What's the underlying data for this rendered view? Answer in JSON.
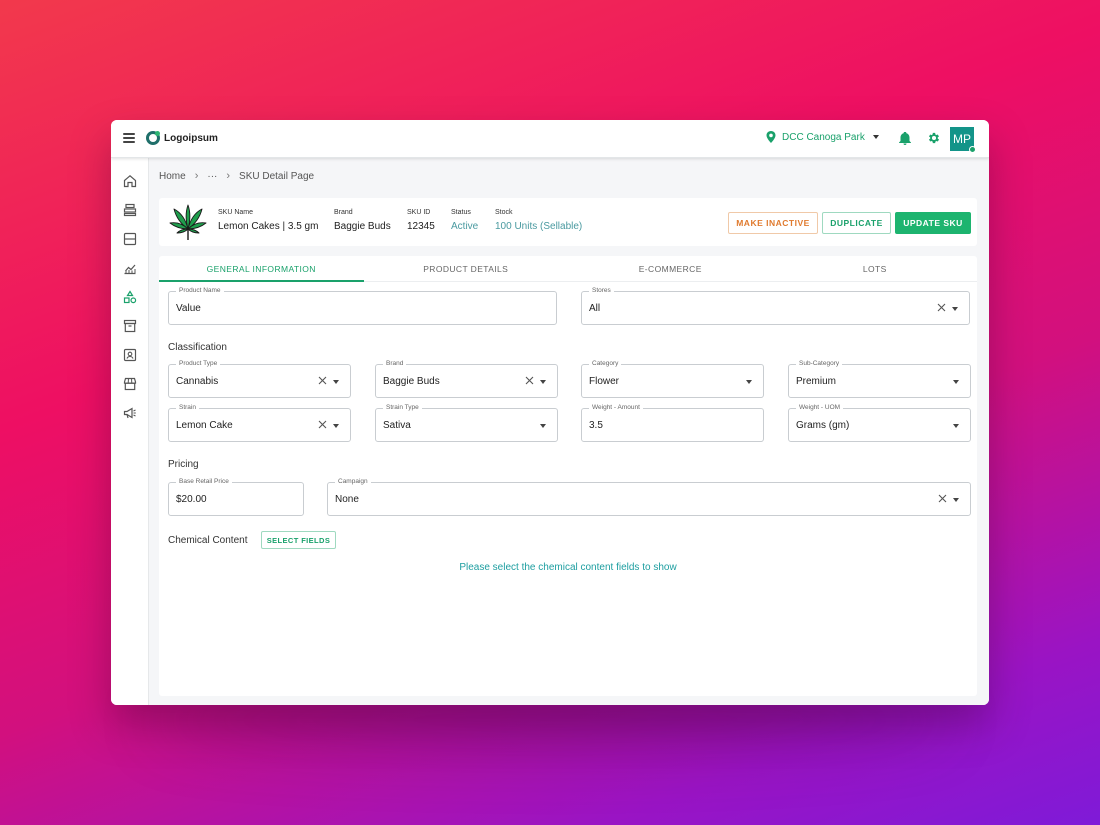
{
  "topbar": {
    "logo_text": "Logoipsum",
    "store_name": "DCC Canoga Park",
    "avatar_initials": "MP"
  },
  "breadcrumb": {
    "home": "Home",
    "ellipsis": "···",
    "current": "SKU Detail Page"
  },
  "sku": {
    "name_label": "SKU Name",
    "name_value": "Lemon Cakes | 3.5 gm",
    "brand_label": "Brand",
    "brand_value": "Baggie Buds",
    "id_label": "SKU ID",
    "id_value": "12345",
    "status_label": "Status",
    "status_value": "Active",
    "stock_label": "Stock",
    "stock_value": "100 Units (Sellable)"
  },
  "actions": {
    "make_inactive": "MAKE INACTIVE",
    "duplicate": "DUPLICATE",
    "update": "UPDATE SKU"
  },
  "tabs": [
    {
      "label": "GENERAL INFORMATION",
      "active": true
    },
    {
      "label": "PRODUCT DETAILS",
      "active": false
    },
    {
      "label": "E-COMMERCE",
      "active": false
    },
    {
      "label": "LOTS",
      "active": false
    }
  ],
  "form": {
    "product_name": {
      "label": "Product Name",
      "value": "Value"
    },
    "stores": {
      "label": "Stores",
      "value": "All"
    },
    "classification_title": "Classification",
    "product_type": {
      "label": "Product Type",
      "value": "Cannabis"
    },
    "brand": {
      "label": "Brand",
      "value": "Baggie Buds"
    },
    "category": {
      "label": "Category",
      "value": "Flower"
    },
    "sub_category": {
      "label": "Sub-Category",
      "value": "Premium"
    },
    "strain": {
      "label": "Strain",
      "value": "Lemon Cake"
    },
    "strain_type": {
      "label": "Strain Type",
      "value": "Sativa"
    },
    "weight_amount": {
      "label": "Weight - Amount",
      "value": "3.5"
    },
    "weight_uom": {
      "label": "Weight - UOM",
      "value": "Grams (gm)"
    },
    "pricing_title": "Pricing",
    "base_price": {
      "label": "Base Retail Price",
      "value": "$20.00"
    },
    "campaign": {
      "label": "Campaign",
      "value": "None"
    },
    "chemical_title": "Chemical Content",
    "select_fields": "SELECT FIELDS",
    "chemical_hint": "Please select the chemical content fields to show"
  },
  "colors": {
    "accent": "#1aa16b",
    "warning": "#e07a2e",
    "avatar_bg": "#139489"
  }
}
